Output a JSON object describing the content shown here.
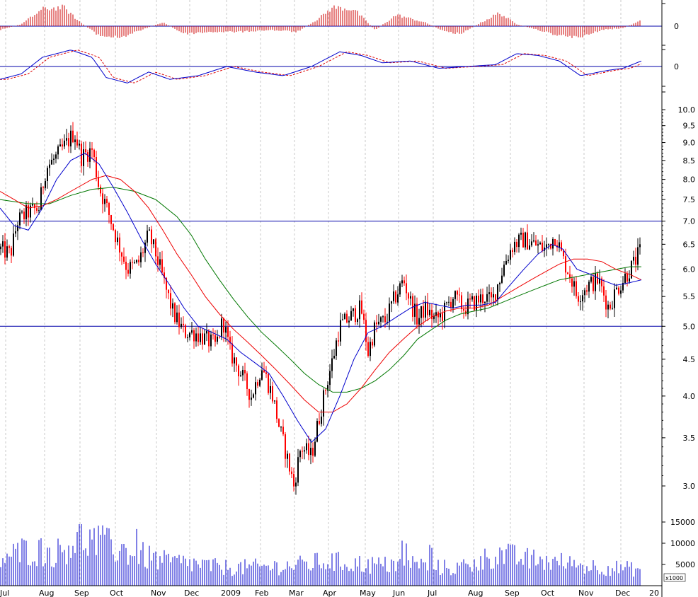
{
  "chart_data": {
    "type": "candlestick",
    "scale": "log",
    "grid": "vertical-dashed",
    "months": [
      "Jul",
      "Aug",
      "Sep",
      "Oct",
      "Nov",
      "Dec",
      "2009",
      "Feb",
      "Mar",
      "Apr",
      "May",
      "Jun",
      "Jul",
      "Aug",
      "Sep",
      "Oct",
      "Nov",
      "Dec",
      "20"
    ],
    "price_axis": {
      "ticks": [
        "10.0",
        "9.5",
        "9.0",
        "8.5",
        "8.0",
        "7.5",
        "7.0",
        "6.5",
        "6.0",
        "5.5",
        "5.0",
        "4.5",
        "4.0",
        "3.5",
        "3.0"
      ],
      "range": [
        2.9,
        10.0
      ]
    },
    "reference_lines": [
      7.0,
      5.0
    ],
    "price_path": [
      [
        0,
        6.4
      ],
      [
        15,
        6.3
      ],
      [
        25,
        7.0
      ],
      [
        40,
        7.2
      ],
      [
        55,
        7.3
      ],
      [
        65,
        8.3
      ],
      [
        80,
        8.6
      ],
      [
        95,
        9.0
      ],
      [
        105,
        9.3
      ],
      [
        115,
        8.6
      ],
      [
        130,
        8.8
      ],
      [
        140,
        7.8
      ],
      [
        155,
        7.1
      ],
      [
        165,
        6.6
      ],
      [
        180,
        6.0
      ],
      [
        195,
        6.1
      ],
      [
        210,
        6.7
      ],
      [
        220,
        6.3
      ],
      [
        235,
        5.6
      ],
      [
        245,
        5.2
      ],
      [
        260,
        4.9
      ],
      [
        275,
        4.9
      ],
      [
        290,
        4.8
      ],
      [
        305,
        4.7
      ],
      [
        315,
        5.1
      ],
      [
        325,
        4.6
      ],
      [
        340,
        4.3
      ],
      [
        355,
        4.0
      ],
      [
        370,
        4.4
      ],
      [
        385,
        4.0
      ],
      [
        395,
        3.6
      ],
      [
        405,
        3.3
      ],
      [
        415,
        3.0
      ],
      [
        425,
        3.4
      ],
      [
        440,
        3.3
      ],
      [
        450,
        3.7
      ],
      [
        460,
        4.1
      ],
      [
        470,
        4.5
      ],
      [
        480,
        5.0
      ],
      [
        490,
        5.1
      ],
      [
        500,
        5.2
      ],
      [
        510,
        5.3
      ],
      [
        520,
        4.6
      ],
      [
        530,
        5.0
      ],
      [
        545,
        5.1
      ],
      [
        555,
        5.4
      ],
      [
        570,
        5.8
      ],
      [
        580,
        5.4
      ],
      [
        590,
        5.1
      ],
      [
        600,
        5.3
      ],
      [
        615,
        5.1
      ],
      [
        625,
        5.2
      ],
      [
        640,
        5.5
      ],
      [
        655,
        5.3
      ],
      [
        670,
        5.4
      ],
      [
        685,
        5.5
      ],
      [
        695,
        5.4
      ],
      [
        705,
        5.8
      ],
      [
        715,
        6.2
      ],
      [
        725,
        6.5
      ],
      [
        740,
        6.6
      ],
      [
        755,
        6.5
      ],
      [
        770,
        6.4
      ],
      [
        785,
        6.7
      ],
      [
        795,
        6.2
      ],
      [
        805,
        5.9
      ],
      [
        815,
        5.5
      ],
      [
        830,
        5.7
      ],
      [
        845,
        5.8
      ],
      [
        860,
        5.3
      ],
      [
        870,
        5.6
      ],
      [
        880,
        5.8
      ],
      [
        895,
        6.1
      ],
      [
        906,
        6.4
      ]
    ],
    "ma_blue_path": [
      [
        0,
        7.3
      ],
      [
        20,
        6.9
      ],
      [
        40,
        6.8
      ],
      [
        60,
        7.3
      ],
      [
        80,
        8.0
      ],
      [
        100,
        8.5
      ],
      [
        120,
        8.7
      ],
      [
        140,
        8.4
      ],
      [
        160,
        7.8
      ],
      [
        180,
        7.2
      ],
      [
        200,
        6.6
      ],
      [
        220,
        6.1
      ],
      [
        240,
        5.7
      ],
      [
        260,
        5.3
      ],
      [
        280,
        5.0
      ],
      [
        300,
        4.9
      ],
      [
        320,
        4.8
      ],
      [
        340,
        4.6
      ],
      [
        360,
        4.45
      ],
      [
        380,
        4.3
      ],
      [
        400,
        4.0
      ],
      [
        420,
        3.7
      ],
      [
        440,
        3.45
      ],
      [
        460,
        3.6
      ],
      [
        480,
        4.0
      ],
      [
        500,
        4.5
      ],
      [
        520,
        4.9
      ],
      [
        540,
        5.0
      ],
      [
        560,
        5.15
      ],
      [
        580,
        5.3
      ],
      [
        600,
        5.4
      ],
      [
        620,
        5.35
      ],
      [
        640,
        5.3
      ],
      [
        660,
        5.35
      ],
      [
        680,
        5.35
      ],
      [
        700,
        5.4
      ],
      [
        720,
        5.7
      ],
      [
        740,
        6.0
      ],
      [
        760,
        6.3
      ],
      [
        780,
        6.5
      ],
      [
        795,
        6.4
      ],
      [
        815,
        6.0
      ],
      [
        835,
        5.9
      ],
      [
        850,
        5.8
      ],
      [
        870,
        5.7
      ],
      [
        890,
        5.75
      ],
      [
        906,
        5.8
      ]
    ],
    "ma_red_path": [
      [
        0,
        7.7
      ],
      [
        20,
        7.5
      ],
      [
        40,
        7.3
      ],
      [
        60,
        7.35
      ],
      [
        80,
        7.5
      ],
      [
        100,
        7.7
      ],
      [
        130,
        8.0
      ],
      [
        150,
        8.1
      ],
      [
        170,
        8.0
      ],
      [
        190,
        7.7
      ],
      [
        210,
        7.3
      ],
      [
        230,
        6.8
      ],
      [
        250,
        6.3
      ],
      [
        270,
        5.9
      ],
      [
        290,
        5.5
      ],
      [
        310,
        5.2
      ],
      [
        330,
        4.95
      ],
      [
        350,
        4.75
      ],
      [
        370,
        4.55
      ],
      [
        390,
        4.35
      ],
      [
        410,
        4.15
      ],
      [
        430,
        3.95
      ],
      [
        450,
        3.8
      ],
      [
        470,
        3.8
      ],
      [
        490,
        3.9
      ],
      [
        510,
        4.1
      ],
      [
        530,
        4.35
      ],
      [
        550,
        4.6
      ],
      [
        570,
        4.8
      ],
      [
        590,
        5.0
      ],
      [
        610,
        5.15
      ],
      [
        630,
        5.25
      ],
      [
        650,
        5.3
      ],
      [
        670,
        5.3
      ],
      [
        690,
        5.35
      ],
      [
        710,
        5.5
      ],
      [
        730,
        5.65
      ],
      [
        750,
        5.8
      ],
      [
        770,
        5.95
      ],
      [
        790,
        6.1
      ],
      [
        810,
        6.2
      ],
      [
        830,
        6.2
      ],
      [
        850,
        6.15
      ],
      [
        870,
        6.0
      ],
      [
        890,
        5.9
      ],
      [
        906,
        5.8
      ]
    ],
    "ma_green_path": [
      [
        0,
        7.5
      ],
      [
        40,
        7.4
      ],
      [
        70,
        7.4
      ],
      [
        100,
        7.6
      ],
      [
        130,
        7.75
      ],
      [
        160,
        7.8
      ],
      [
        190,
        7.7
      ],
      [
        220,
        7.5
      ],
      [
        250,
        7.1
      ],
      [
        270,
        6.7
      ],
      [
        290,
        6.2
      ],
      [
        310,
        5.8
      ],
      [
        330,
        5.45
      ],
      [
        350,
        5.15
      ],
      [
        370,
        4.9
      ],
      [
        390,
        4.7
      ],
      [
        410,
        4.5
      ],
      [
        430,
        4.3
      ],
      [
        450,
        4.15
      ],
      [
        470,
        4.05
      ],
      [
        490,
        4.05
      ],
      [
        510,
        4.1
      ],
      [
        530,
        4.2
      ],
      [
        550,
        4.35
      ],
      [
        570,
        4.55
      ],
      [
        590,
        4.8
      ],
      [
        610,
        4.95
      ],
      [
        630,
        5.1
      ],
      [
        650,
        5.2
      ],
      [
        670,
        5.25
      ],
      [
        690,
        5.3
      ],
      [
        710,
        5.4
      ],
      [
        730,
        5.5
      ],
      [
        750,
        5.6
      ],
      [
        770,
        5.7
      ],
      [
        790,
        5.8
      ],
      [
        810,
        5.85
      ],
      [
        830,
        5.9
      ],
      [
        850,
        5.95
      ],
      [
        870,
        6.0
      ],
      [
        890,
        6.05
      ],
      [
        906,
        6.05
      ]
    ],
    "macd_axis": {
      "tick": "0"
    },
    "macd_histogram_path": [
      [
        0,
        -0.2
      ],
      [
        30,
        0.1
      ],
      [
        60,
        0.9
      ],
      [
        90,
        1.0
      ],
      [
        110,
        0.3
      ],
      [
        140,
        -0.5
      ],
      [
        170,
        -0.6
      ],
      [
        200,
        -0.2
      ],
      [
        230,
        0.2
      ],
      [
        260,
        -0.4
      ],
      [
        300,
        -0.3
      ],
      [
        340,
        -0.3
      ],
      [
        380,
        -0.2
      ],
      [
        420,
        -0.3
      ],
      [
        450,
        0.4
      ],
      [
        470,
        1.0
      ],
      [
        500,
        0.9
      ],
      [
        530,
        -0.2
      ],
      [
        560,
        0.6
      ],
      [
        580,
        0.4
      ],
      [
        600,
        0.2
      ],
      [
        630,
        -0.3
      ],
      [
        650,
        -0.4
      ],
      [
        680,
        0.2
      ],
      [
        705,
        0.7
      ],
      [
        730,
        0.1
      ],
      [
        760,
        -0.2
      ],
      [
        790,
        -0.5
      ],
      [
        820,
        -0.6
      ],
      [
        850,
        -0.2
      ],
      [
        880,
        -0.1
      ],
      [
        906,
        0.3
      ]
    ],
    "oscillator_axis": {
      "tick": "0"
    },
    "oscillator_path": [
      [
        0,
        -0.7
      ],
      [
        30,
        -0.4
      ],
      [
        60,
        0.5
      ],
      [
        100,
        0.9
      ],
      [
        130,
        0.5
      ],
      [
        150,
        -0.6
      ],
      [
        180,
        -0.9
      ],
      [
        210,
        -0.3
      ],
      [
        240,
        -0.7
      ],
      [
        280,
        -0.5
      ],
      [
        320,
        0.0
      ],
      [
        360,
        -0.3
      ],
      [
        400,
        -0.5
      ],
      [
        440,
        0.0
      ],
      [
        480,
        0.8
      ],
      [
        510,
        0.6
      ],
      [
        540,
        0.2
      ],
      [
        580,
        0.3
      ],
      [
        620,
        -0.1
      ],
      [
        660,
        0.0
      ],
      [
        700,
        0.1
      ],
      [
        730,
        0.7
      ],
      [
        760,
        0.6
      ],
      [
        790,
        0.3
      ],
      [
        820,
        -0.5
      ],
      [
        860,
        -0.2
      ],
      [
        880,
        -0.1
      ],
      [
        906,
        0.3
      ]
    ],
    "volume_axis": {
      "ticks": [
        "15000",
        "10000",
        "5000"
      ],
      "unit": "x1000"
    },
    "volume_profile": [
      [
        0,
        6500
      ],
      [
        40,
        9000
      ],
      [
        80,
        8000
      ],
      [
        110,
        12000
      ],
      [
        150,
        10000
      ],
      [
        190,
        8000
      ],
      [
        230,
        6000
      ],
      [
        270,
        5500
      ],
      [
        310,
        4500
      ],
      [
        350,
        4500
      ],
      [
        390,
        4800
      ],
      [
        420,
        5000
      ],
      [
        460,
        6000
      ],
      [
        500,
        5500
      ],
      [
        540,
        5000
      ],
      [
        580,
        5500
      ],
      [
        620,
        4500
      ],
      [
        660,
        4300
      ],
      [
        700,
        8000
      ],
      [
        740,
        6500
      ],
      [
        780,
        6000
      ],
      [
        820,
        5000
      ],
      [
        860,
        4500
      ],
      [
        906,
        4000
      ]
    ]
  }
}
